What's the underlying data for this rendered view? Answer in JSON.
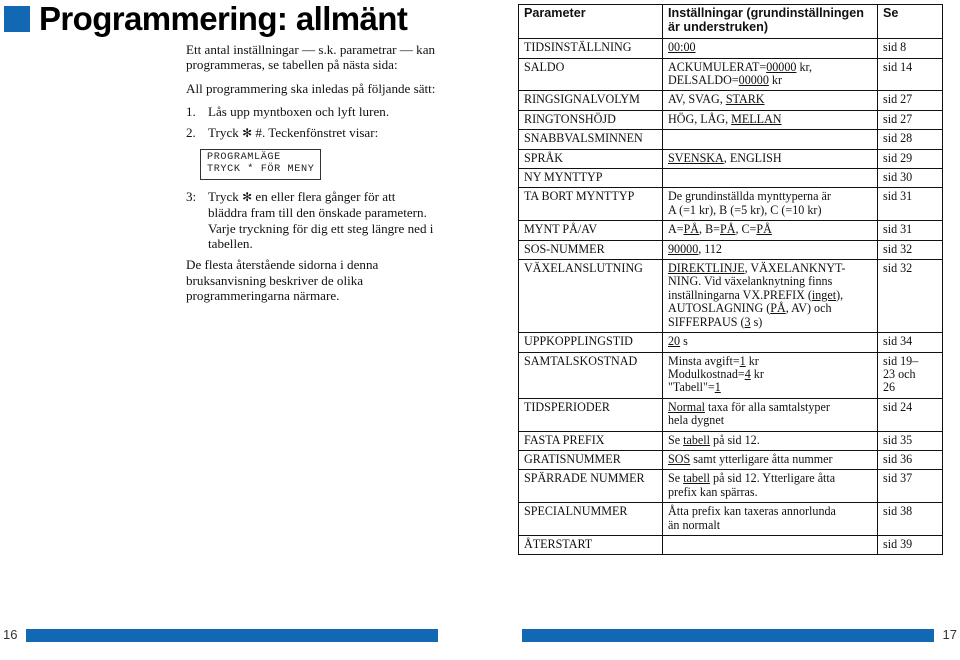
{
  "heading": {
    "title": "Programmering: allmänt",
    "accent_color": "#1268b3"
  },
  "intro": {
    "paragraph_1": "Ett antal inställningar — s.k. parametrar — kan programmeras, se tabellen på nästa sida:",
    "paragraph_2": "All programmering ska inledas på följande sätt:"
  },
  "steps": [
    {
      "num": "1.",
      "text_before": "Lås upp myntboxen och lyft luren.",
      "symbol": "",
      "text_after": ""
    },
    {
      "num": "2.",
      "text_before": "Tryck ",
      "symbol": "✻",
      "text_after": " #. Teckenfönstret visar:"
    }
  ],
  "display_box": {
    "line_1": "PROGRAMLÄGE",
    "line_2": "TRYCK * FÖR MENY"
  },
  "step_3": {
    "num": "3:",
    "text_before": "Tryck ",
    "symbol": "✻",
    "text_after": " en eller flera gånger för att bläddra fram till den önskade parametern. Varje tryckning för dig ett steg längre ned i tabellen."
  },
  "closing": "De flesta återstående sidorna i denna bruksanvisning beskriver de olika programmeringarna närmare.",
  "table": {
    "headers": {
      "parameter": "Parameter",
      "settings": "Inställningar (grundinställningen är understruken)",
      "see": "Se"
    },
    "rows": [
      {
        "parameter": "TIDSINSTÄLLNING",
        "settings_html": "<u>00:00</u>",
        "see": "sid 8"
      },
      {
        "parameter": "SALDO",
        "settings_html": "ACKUMULERAT=<u>00000</u> kr,<br>DELSALDO=<u>00000</u> kr",
        "see": "sid 14"
      },
      {
        "parameter": "RINGSIGNALVOLYM",
        "settings_html": "AV, SVAG, <u>STARK</u>",
        "see": "sid 27"
      },
      {
        "parameter": "RINGTONSHÖJD",
        "settings_html": "HÖG, LÅG, <u>MELLAN</u>",
        "see": "sid 27"
      },
      {
        "parameter": "SNABBVALSMINNEN",
        "settings_html": "",
        "see": "sid 28"
      },
      {
        "parameter": "SPRÅK",
        "settings_html": "<u>SVENSKA</u>, ENGLISH",
        "see": "sid 29"
      },
      {
        "parameter": "NY MYNTTYP",
        "settings_html": "",
        "see": "sid 30"
      },
      {
        "parameter": "TA BORT MYNTTYP",
        "settings_html": "De grundinställda mynttyperna är<br>A (=1 kr), B (=5 kr), C (=10 kr)",
        "see": "sid 31"
      },
      {
        "parameter": "MYNT PÅ/AV",
        "settings_html": "A=<u>PÅ</u>, B=<u>PÅ</u>, C=<u>PÅ</u>",
        "see": "sid 31"
      },
      {
        "parameter": "SOS-NUMMER",
        "settings_html": "<u>90000</u>, 112",
        "see": "sid 32"
      },
      {
        "parameter": "VÄXELANSLUTNING",
        "settings_html": "<u>DIREKTLINJE</u>, VÄXELANKNYT-<br>NING. Vid växelanknytning finns<br>inställningarna VX.PREFIX (<u>inget</u>),<br>AUTOSLAGNING (<u>PÅ</u>, AV) och<br>SIFFERPAUS (<u>3</u> s)",
        "see": "sid 32"
      },
      {
        "parameter": "UPPKOPPLINGSTID",
        "settings_html": "<u>20</u> s",
        "see": "sid 34"
      },
      {
        "parameter": "SAMTALSKOSTNAD",
        "settings_html": "Minsta avgift=<u>1</u> kr<br>Modulkostnad=<u>4</u> kr<br>\"Tabell\"=<u>1</u>",
        "see": "sid 19–\n23 och\n26"
      },
      {
        "parameter": "TIDSPERIODER",
        "settings_html": "<u>Normal</u> taxa för alla samtalstyper<br>hela dygnet",
        "see": "sid 24"
      },
      {
        "parameter": "FASTA PREFIX",
        "settings_html": "Se <u>tabell</u> på sid 12.",
        "see": "sid 35"
      },
      {
        "parameter": "GRATISNUMMER",
        "settings_html": "<u>SOS</u> samt ytterligare åtta nummer",
        "see": "sid 36"
      },
      {
        "parameter": "SPÄRRADE NUMMER",
        "settings_html": "Se <u>tabell</u> på sid 12. Ytterligare åtta<br>prefix kan spärras.",
        "see": "sid 37"
      },
      {
        "parameter": "SPECIALNUMMER",
        "settings_html": "Åtta prefix kan taxeras annorlunda<br>än normalt",
        "see": "sid 38"
      },
      {
        "parameter": "ÅTERSTART",
        "settings_html": "",
        "see": "sid 39"
      }
    ]
  },
  "footer": {
    "left_page_number": "16",
    "right_page_number": "17"
  }
}
